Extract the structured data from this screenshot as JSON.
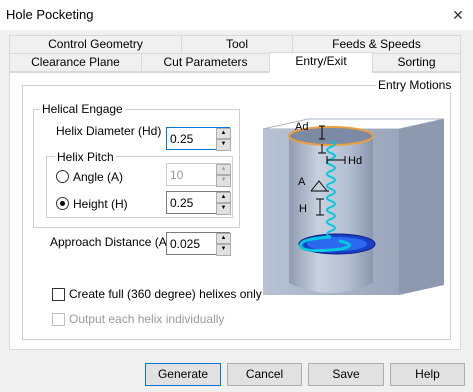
{
  "window": {
    "title": "Hole Pocketing",
    "close_glyph": "✕"
  },
  "tabs_top": [
    {
      "label": "Control Geometry"
    },
    {
      "label": "Tool"
    },
    {
      "label": "Feeds & Speeds"
    }
  ],
  "tabs_bottom": [
    {
      "label": "Clearance Plane"
    },
    {
      "label": "Cut Parameters"
    },
    {
      "label": "Entry/Exit",
      "active": true
    },
    {
      "label": "Sorting"
    }
  ],
  "entry_motions": {
    "label": "Entry Motions",
    "helical_engage": {
      "label": "Helical Engage",
      "helix_diameter": {
        "label": "Helix Diameter (Hd)",
        "value": "0.25"
      },
      "helix_pitch": {
        "label": "Helix Pitch",
        "angle": {
          "label": "Angle (A)",
          "value": "10",
          "selected": false
        },
        "height": {
          "label": "Height (H)",
          "value": "0.25",
          "selected": true
        }
      }
    },
    "approach_distance": {
      "label": "Approach Distance (Ad)",
      "value": "0.025"
    },
    "full_helixes": {
      "label": "Create full (360 degree) helixes only",
      "checked": false
    },
    "output_individually": {
      "label": "Output each helix individually",
      "checked": false,
      "enabled": false
    },
    "diagram_labels": {
      "ad": "Ad",
      "hd": "Hd",
      "a": "A",
      "h": "H"
    }
  },
  "buttons": {
    "generate": "Generate",
    "cancel": "Cancel",
    "save": "Save",
    "help": "Help"
  },
  "colors": {
    "accent": "#0078d7",
    "helix": "#00c8e0",
    "cylinder": "#a8b6cc",
    "rim": "#e8a040"
  }
}
